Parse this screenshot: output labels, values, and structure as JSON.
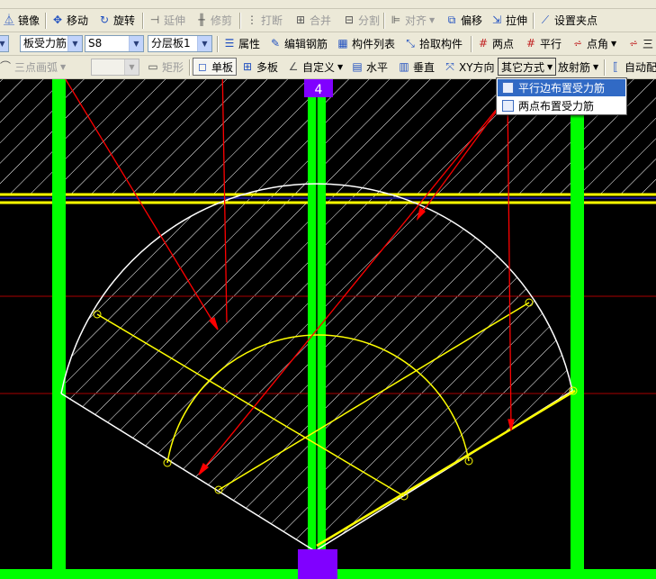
{
  "toolbar1": {
    "mirror": "镜像",
    "move": "移动",
    "rotate": "旋转",
    "extend": "延伸",
    "trim": "修剪",
    "break": "打断",
    "merge": "合并",
    "split": "分割",
    "align": "对齐",
    "offset": "偏移",
    "stretch": "拉伸",
    "grip": "设置夹点"
  },
  "toolbar2": {
    "type_combo": "板受力筋",
    "name_combo": "S8",
    "layer_combo": "分层板1",
    "properties": "属性",
    "edit_rebar": "编辑钢筋",
    "component_list": "构件列表",
    "pick_component": "拾取构件",
    "two_points": "两点",
    "parallel": "平行",
    "point_angle": "点角",
    "three": "三"
  },
  "toolbar3": {
    "three_point_arc": "三点画弧",
    "rectangle": "矩形",
    "single_board": "单板",
    "multi_board": "多板",
    "custom": "自定义",
    "horizontal": "水平",
    "vertical": "垂直",
    "xy_direction": "XY方向",
    "other_method": "其它方式",
    "radial_rebar": "放射筋",
    "auto_config": "自动配"
  },
  "dropdown": {
    "items": [
      "平行边布置受力筋",
      "两点布置受力筋"
    ],
    "selected_index": 0
  },
  "canvas": {
    "axis_label": "4"
  },
  "colors": {
    "background": "#000000",
    "beam_green": "#00ff00",
    "yellow_line": "#ffff00",
    "arc_white": "#ffffff",
    "marker_purple": "#8000ff",
    "annotation_red": "#ff0000"
  }
}
